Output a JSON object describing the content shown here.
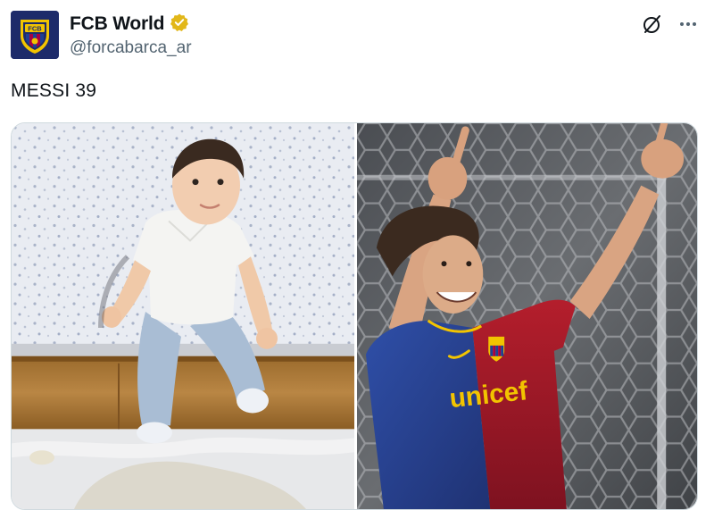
{
  "account": {
    "display_name": "FCB World",
    "handle": "@forcabarca_ar",
    "verified": true,
    "avatar_text": "FCB",
    "avatar_colors": {
      "background": "#1d2b6a",
      "crest": "#f2c400",
      "stripe_blue": "#1c3f94",
      "stripe_red": "#a50044"
    }
  },
  "actions": {
    "grok_icon": "slash-circle-icon",
    "more_icon": "more-dots-icon"
  },
  "tweet": {
    "text": "MESSI 39"
  },
  "media": {
    "photos": [
      {
        "name": "photo-baby",
        "alt": ""
      },
      {
        "name": "photo-celebration",
        "alt": "",
        "shirt_text": "unicef"
      }
    ]
  },
  "colors": {
    "text_primary": "#0f1419",
    "text_secondary": "#536471",
    "verified_gold": "#e2b719",
    "border": "#cfd9de"
  }
}
